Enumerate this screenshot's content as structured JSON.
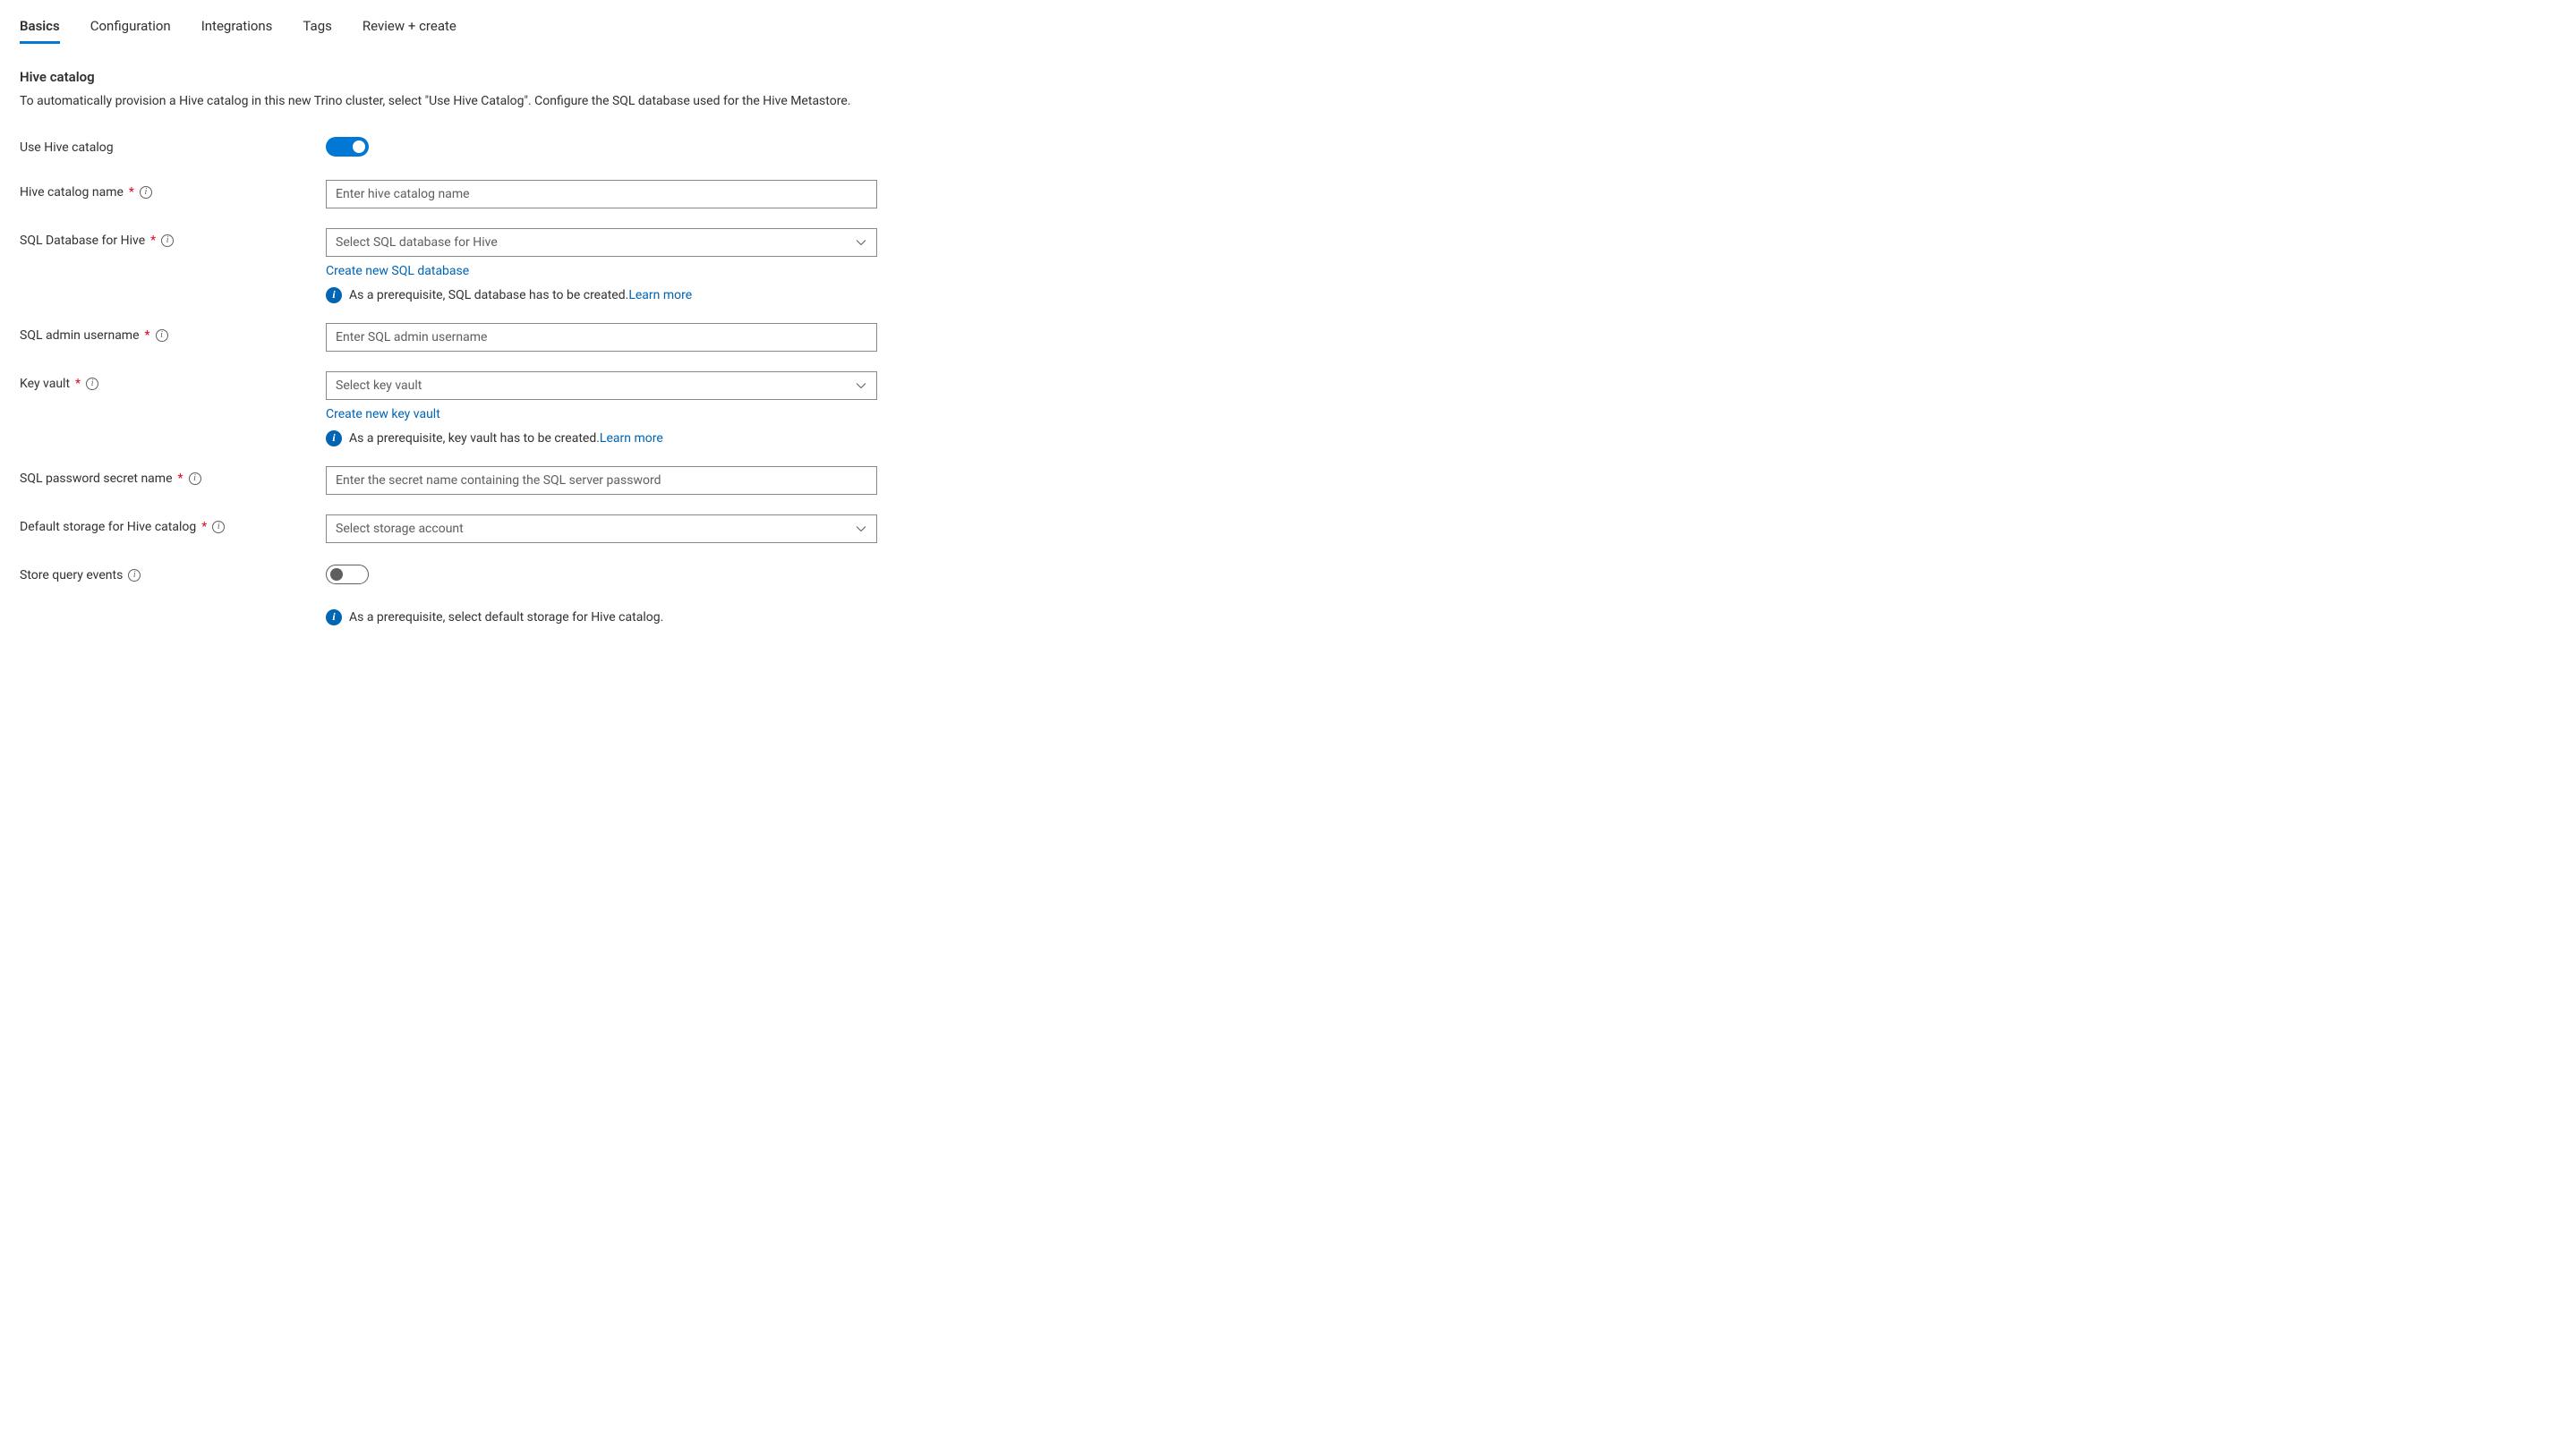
{
  "tabs": {
    "basics": "Basics",
    "configuration": "Configuration",
    "integrations": "Integrations",
    "tags": "Tags",
    "review": "Review + create"
  },
  "section": {
    "title": "Hive catalog",
    "description": "To automatically provision a Hive catalog in this new Trino cluster, select \"Use Hive Catalog\". Configure the SQL database used for the Hive Metastore."
  },
  "labels": {
    "use_hive_catalog": "Use Hive catalog",
    "hive_catalog_name": "Hive catalog name",
    "sql_database": "SQL Database for Hive",
    "sql_admin_username": "SQL admin username",
    "key_vault": "Key vault",
    "sql_password_secret": "SQL password secret name",
    "default_storage": "Default storage for Hive catalog",
    "store_query_events": "Store query events"
  },
  "placeholders": {
    "hive_catalog_name": "Enter hive catalog name",
    "sql_database": "Select SQL database for Hive",
    "sql_admin_username": "Enter SQL admin username",
    "key_vault": "Select key vault",
    "sql_password_secret": "Enter the secret name containing the SQL server password",
    "default_storage": "Select storage account"
  },
  "links": {
    "create_sql": "Create new SQL database",
    "create_key_vault": "Create new key vault",
    "learn_more": "Learn more"
  },
  "infos": {
    "sql_prereq": "As a prerequisite, SQL database has to be created.",
    "key_vault_prereq": "As a prerequisite, key vault has to be created.",
    "storage_prereq": "As a prerequisite, select default storage for Hive catalog."
  },
  "toggles": {
    "use_hive_catalog": true,
    "store_query_events": false
  }
}
